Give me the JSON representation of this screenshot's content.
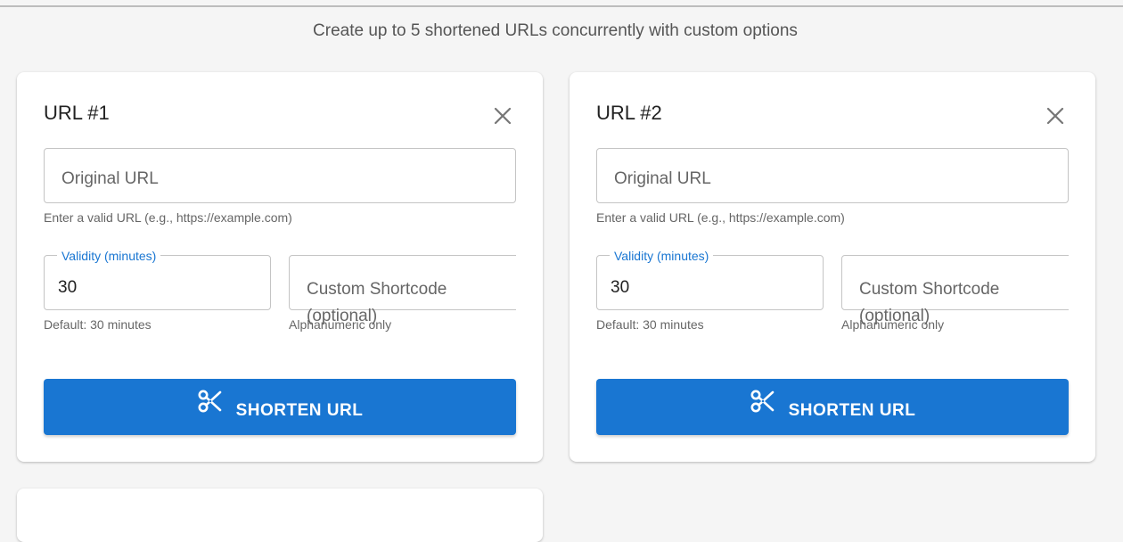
{
  "header": {
    "subtitle": "Create up to 5 shortened URLs concurrently with custom options"
  },
  "cards": [
    {
      "title": "URL #1",
      "close_icon": "close-icon",
      "original_url": {
        "placeholder": "Original URL",
        "value": "",
        "helper": "Enter a valid URL (e.g., https://example.com)"
      },
      "validity": {
        "label": "Validity (minutes)",
        "value": "30",
        "helper": "Default: 30 minutes"
      },
      "shortcode": {
        "placeholder": "Custom Shortcode (optional)",
        "value": "",
        "helper": "Alphanumeric only"
      },
      "shorten_button": {
        "label": "SHORTEN URL",
        "icon": "scissors-icon"
      }
    },
    {
      "title": "URL #2",
      "close_icon": "close-icon",
      "original_url": {
        "placeholder": "Original URL",
        "value": "",
        "helper": "Enter a valid URL (e.g., https://example.com)"
      },
      "validity": {
        "label": "Validity (minutes)",
        "value": "30",
        "helper": "Default: 30 minutes"
      },
      "shortcode": {
        "placeholder": "Custom Shortcode (optional)",
        "value": "",
        "helper": "Alphanumeric only"
      },
      "shorten_button": {
        "label": "SHORTEN URL",
        "icon": "scissors-icon"
      }
    }
  ],
  "colors": {
    "primary": "#1976d2",
    "background": "#f5f5f5",
    "card": "#ffffff",
    "border": "#c4c4c4"
  }
}
